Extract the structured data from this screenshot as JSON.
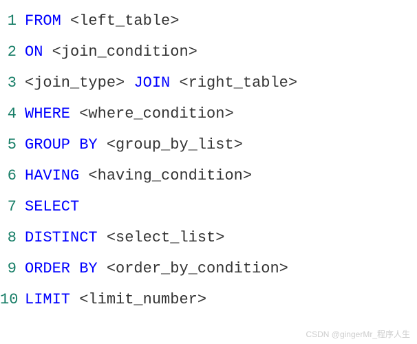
{
  "lines": [
    {
      "num": "1",
      "tokens": [
        {
          "type": "keyword",
          "text": "FROM"
        },
        {
          "type": "plain",
          "text": " "
        },
        {
          "type": "placeholder",
          "text": "<left_table>"
        }
      ]
    },
    {
      "num": "2",
      "tokens": [
        {
          "type": "keyword",
          "text": "ON"
        },
        {
          "type": "plain",
          "text": " "
        },
        {
          "type": "placeholder",
          "text": "<join_condition>"
        }
      ]
    },
    {
      "num": "3",
      "tokens": [
        {
          "type": "placeholder",
          "text": "<join_type>"
        },
        {
          "type": "plain",
          "text": " "
        },
        {
          "type": "keyword",
          "text": "JOIN"
        },
        {
          "type": "plain",
          "text": " "
        },
        {
          "type": "placeholder",
          "text": "<right_table>"
        }
      ]
    },
    {
      "num": "4",
      "tokens": [
        {
          "type": "keyword",
          "text": "WHERE"
        },
        {
          "type": "plain",
          "text": " "
        },
        {
          "type": "placeholder",
          "text": "<where_condition>"
        }
      ]
    },
    {
      "num": "5",
      "tokens": [
        {
          "type": "keyword",
          "text": "GROUP"
        },
        {
          "type": "plain",
          "text": " "
        },
        {
          "type": "keyword",
          "text": "BY"
        },
        {
          "type": "plain",
          "text": " "
        },
        {
          "type": "placeholder",
          "text": "<group_by_list>"
        }
      ]
    },
    {
      "num": "6",
      "tokens": [
        {
          "type": "keyword",
          "text": "HAVING"
        },
        {
          "type": "plain",
          "text": " "
        },
        {
          "type": "placeholder",
          "text": "<having_condition>"
        }
      ]
    },
    {
      "num": "7",
      "tokens": [
        {
          "type": "keyword",
          "text": "SELECT"
        }
      ]
    },
    {
      "num": "8",
      "tokens": [
        {
          "type": "keyword",
          "text": "DISTINCT"
        },
        {
          "type": "plain",
          "text": " "
        },
        {
          "type": "placeholder",
          "text": "<select_list>"
        }
      ]
    },
    {
      "num": "9",
      "tokens": [
        {
          "type": "keyword",
          "text": "ORDER"
        },
        {
          "type": "plain",
          "text": " "
        },
        {
          "type": "keyword",
          "text": "BY"
        },
        {
          "type": "plain",
          "text": " "
        },
        {
          "type": "placeholder",
          "text": "<order_by_condition>"
        }
      ]
    },
    {
      "num": "10",
      "tokens": [
        {
          "type": "keyword",
          "text": "LIMIT"
        },
        {
          "type": "plain",
          "text": " "
        },
        {
          "type": "placeholder",
          "text": "<limit_number>"
        }
      ]
    }
  ],
  "watermark": "CSDN @gingerMr_程序人生"
}
